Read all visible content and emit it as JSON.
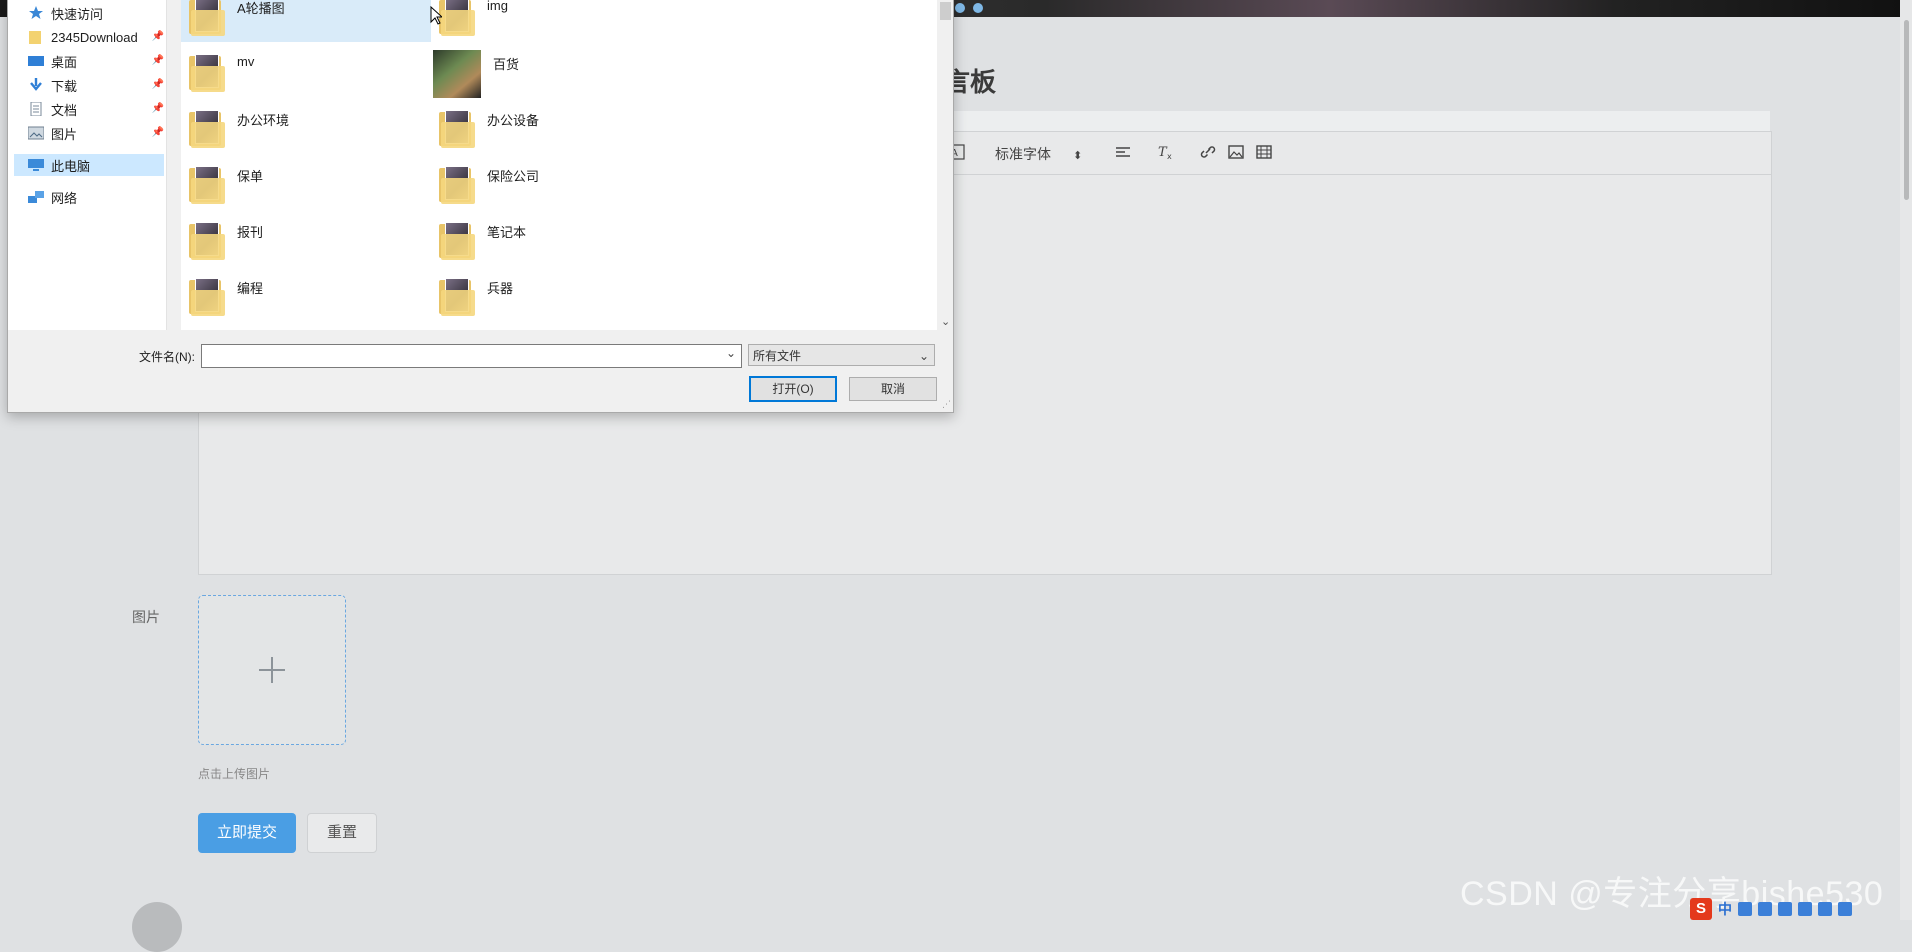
{
  "page": {
    "heading": "言板",
    "editor": {
      "font_select": "标准字体",
      "font_arrows": "⬍"
    },
    "image_label": "图片",
    "upload_hint": "点击上传图片",
    "submit_label": "立即提交",
    "reset_label": "重置",
    "watermark": "CSDN @专注分享bishe530",
    "tray": {
      "ime_logo": "S",
      "ime_lang": "中"
    }
  },
  "dialog": {
    "nav": [
      {
        "label": "快速访问",
        "icon": "star-icon",
        "pinned": false
      },
      {
        "label": "2345Download",
        "icon": "folder-icon",
        "pinned": true
      },
      {
        "label": "桌面",
        "icon": "desktop-icon",
        "pinned": true
      },
      {
        "label": "下载",
        "icon": "download-icon",
        "pinned": true
      },
      {
        "label": "文档",
        "icon": "document-icon",
        "pinned": true
      },
      {
        "label": "图片",
        "icon": "pictures-icon",
        "pinned": true
      },
      {
        "label": "此电脑",
        "icon": "computer-icon",
        "pinned": false
      },
      {
        "label": "网络",
        "icon": "network-icon",
        "pinned": false
      }
    ],
    "files": [
      {
        "name": "A轮播图",
        "type": "folder"
      },
      {
        "name": "img",
        "type": "folder"
      },
      {
        "name": "mv",
        "type": "folder"
      },
      {
        "name": "百货",
        "type": "image"
      },
      {
        "name": "办公环境",
        "type": "folder"
      },
      {
        "name": "办公设备",
        "type": "folder"
      },
      {
        "name": "保单",
        "type": "folder"
      },
      {
        "name": "保险公司",
        "type": "folder"
      },
      {
        "name": "报刊",
        "type": "folder"
      },
      {
        "name": "笔记本",
        "type": "folder"
      },
      {
        "name": "编程",
        "type": "folder"
      },
      {
        "name": "兵器",
        "type": "folder"
      }
    ],
    "filename_label": "文件名(N):",
    "filename_value": "",
    "filetype_value": "所有文件",
    "open_label": "打开(O)",
    "cancel_label": "取消"
  },
  "colors": {
    "primary": "#4a9ee4",
    "dialog_accent": "#0078d7",
    "selection": "#cce8ff"
  }
}
